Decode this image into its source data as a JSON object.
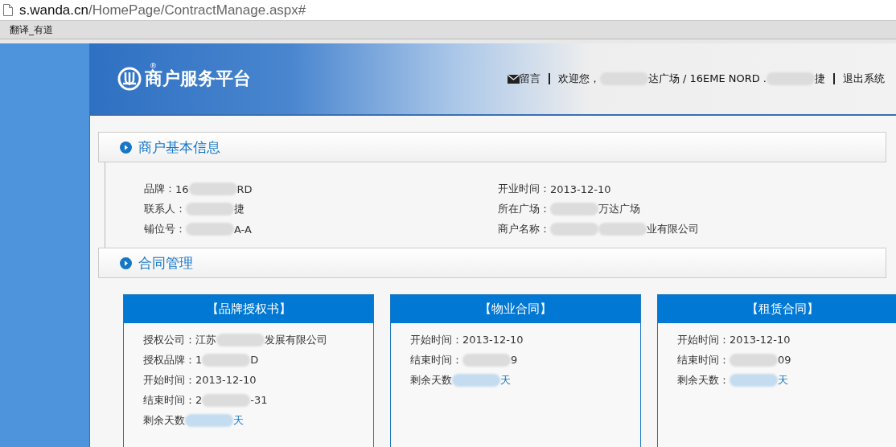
{
  "browser": {
    "url_host": "s.wanda.cn",
    "url_path": "/HomePage/ContractManage.aspx#",
    "bookmark": "翻译_有道"
  },
  "header": {
    "logo_text": "商户服务平台",
    "logo_mark": "®",
    "message": "留言",
    "welcome": [
      {
        "kind": "text",
        "text": "欢迎您，"
      },
      {
        "kind": "blur"
      },
      {
        "kind": "text",
        "text": "达广场 / 16EME NORD ."
      },
      {
        "kind": "blur"
      },
      {
        "kind": "text",
        "text": "捷"
      }
    ],
    "logout": "退出系统"
  },
  "sections": [
    {
      "title": "商户基本信息"
    },
    {
      "title": "合同管理"
    }
  ],
  "info": [
    {
      "label": "品牌：",
      "parts": [
        {
          "kind": "text",
          "text": "16"
        },
        {
          "kind": "blur"
        },
        {
          "kind": "text",
          "text": "RD"
        }
      ]
    },
    {
      "label": "开业时间：",
      "parts": [
        {
          "kind": "text",
          "text": "2013-12-10"
        }
      ]
    },
    {
      "label": "联系人：",
      "parts": [
        {
          "kind": "blur"
        },
        {
          "kind": "text",
          "text": "捷"
        }
      ]
    },
    {
      "label": "所在广场：",
      "parts": [
        {
          "kind": "blur"
        },
        {
          "kind": "text",
          "text": "万达广场"
        }
      ]
    },
    {
      "label": "铺位号：",
      "parts": [
        {
          "kind": "blur"
        },
        {
          "kind": "text",
          "text": "A-A"
        }
      ]
    },
    {
      "label": "商户名称：",
      "parts": [
        {
          "kind": "blur"
        },
        {
          "kind": "blur"
        },
        {
          "kind": "text",
          "text": "业有限公司"
        }
      ]
    }
  ],
  "cards": [
    {
      "title": "【品牌授权书】",
      "lines": [
        {
          "label": "授权公司：",
          "parts": [
            {
              "kind": "text",
              "text": "江苏"
            },
            {
              "kind": "blur"
            },
            {
              "kind": "text",
              "text": "发展有限公司"
            }
          ]
        },
        {
          "label": "授权品牌：",
          "parts": [
            {
              "kind": "text",
              "text": "1"
            },
            {
              "kind": "blur"
            },
            {
              "kind": "text",
              "text": "D"
            }
          ]
        },
        {
          "label": "开始时间：",
          "parts": [
            {
              "kind": "text",
              "text": "2013-12-10"
            }
          ]
        },
        {
          "label": "结束时间：",
          "parts": [
            {
              "kind": "text",
              "text": "2"
            },
            {
              "kind": "blur"
            },
            {
              "kind": "text",
              "text": "-31"
            }
          ]
        },
        {
          "label": "剩余天数",
          "parts": [
            {
              "kind": "blur"
            },
            {
              "kind": "link",
              "text": "天"
            }
          ]
        }
      ]
    },
    {
      "title": "【物业合同】",
      "lines": [
        {
          "label": "开始时间：",
          "parts": [
            {
              "kind": "text",
              "text": "2013-12-10"
            }
          ]
        },
        {
          "label": "结束时间：",
          "parts": [
            {
              "kind": "blur"
            },
            {
              "kind": "text",
              "text": "9"
            }
          ]
        },
        {
          "label": "剩余天数",
          "parts": [
            {
              "kind": "blur"
            },
            {
              "kind": "link",
              "text": "天"
            }
          ]
        }
      ]
    },
    {
      "title": "【租赁合同】",
      "lines": [
        {
          "label": "开始时间：",
          "parts": [
            {
              "kind": "text",
              "text": "2013-12-10"
            }
          ]
        },
        {
          "label": "结束时间：",
          "parts": [
            {
              "kind": "blur"
            },
            {
              "kind": "text",
              "text": "09"
            }
          ]
        },
        {
          "label": "剩余天数：",
          "parts": [
            {
              "kind": "blur"
            },
            {
              "kind": "link",
              "text": "天"
            }
          ]
        }
      ]
    }
  ]
}
